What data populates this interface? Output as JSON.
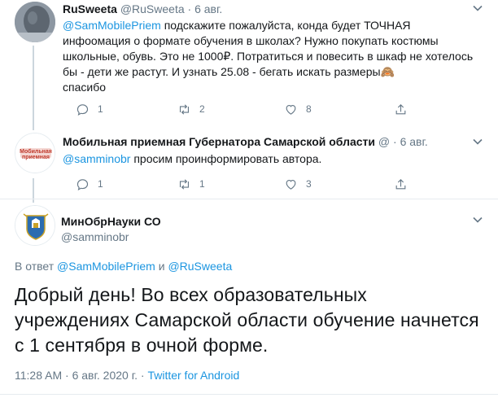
{
  "tweet1": {
    "name": "RuSweeta",
    "handle": "@RuSweeta",
    "sep": "·",
    "date": "6 авг.",
    "mention": "@SamMobilePriem",
    "text": " подскажите пожалуйста, конда будет ТОЧНАЯ инфоомация о формате обучения в школах? Нужно покупать костюмы школьные, обувь. Это не 1000₽. Потратиться и повесить в шкаф не хотелось бы - дети же растут. И узнать 25.08 - бегать искать размеры",
    "emoji": "🙈",
    "text_end": "спасибо",
    "replies": "1",
    "retweets": "2",
    "likes": "8"
  },
  "tweet2": {
    "name": "Мобильная приемная Губернатора Самарской области",
    "handle": "@",
    "sep": "·",
    "date": "6 авг.",
    "avatar_text": "Мобильная приемная",
    "mention": "@samminobr",
    "text": " просим проинформировать автора.",
    "replies": "1",
    "retweets": "1",
    "likes": "3"
  },
  "main": {
    "name": "МинОбрНауки СО",
    "handle": "@samminobr",
    "replying_prefix": "В ответ ",
    "replying_to_1": "@SamMobilePriem",
    "replying_and": " и ",
    "replying_to_2": "@RuSweeta",
    "text": "Добрый день! Во всех образовательных учреждениях Самарской области обучение начнется с 1 сентября в очной форме.",
    "time": "11:28 AM",
    "sep1": " · ",
    "date": "6 авг. 2020 г.",
    "sep2": " · ",
    "source": "Twitter for Android"
  },
  "colors": {
    "link": "#1b95e0",
    "secondary": "#657786",
    "divider": "#e6ecf0"
  }
}
